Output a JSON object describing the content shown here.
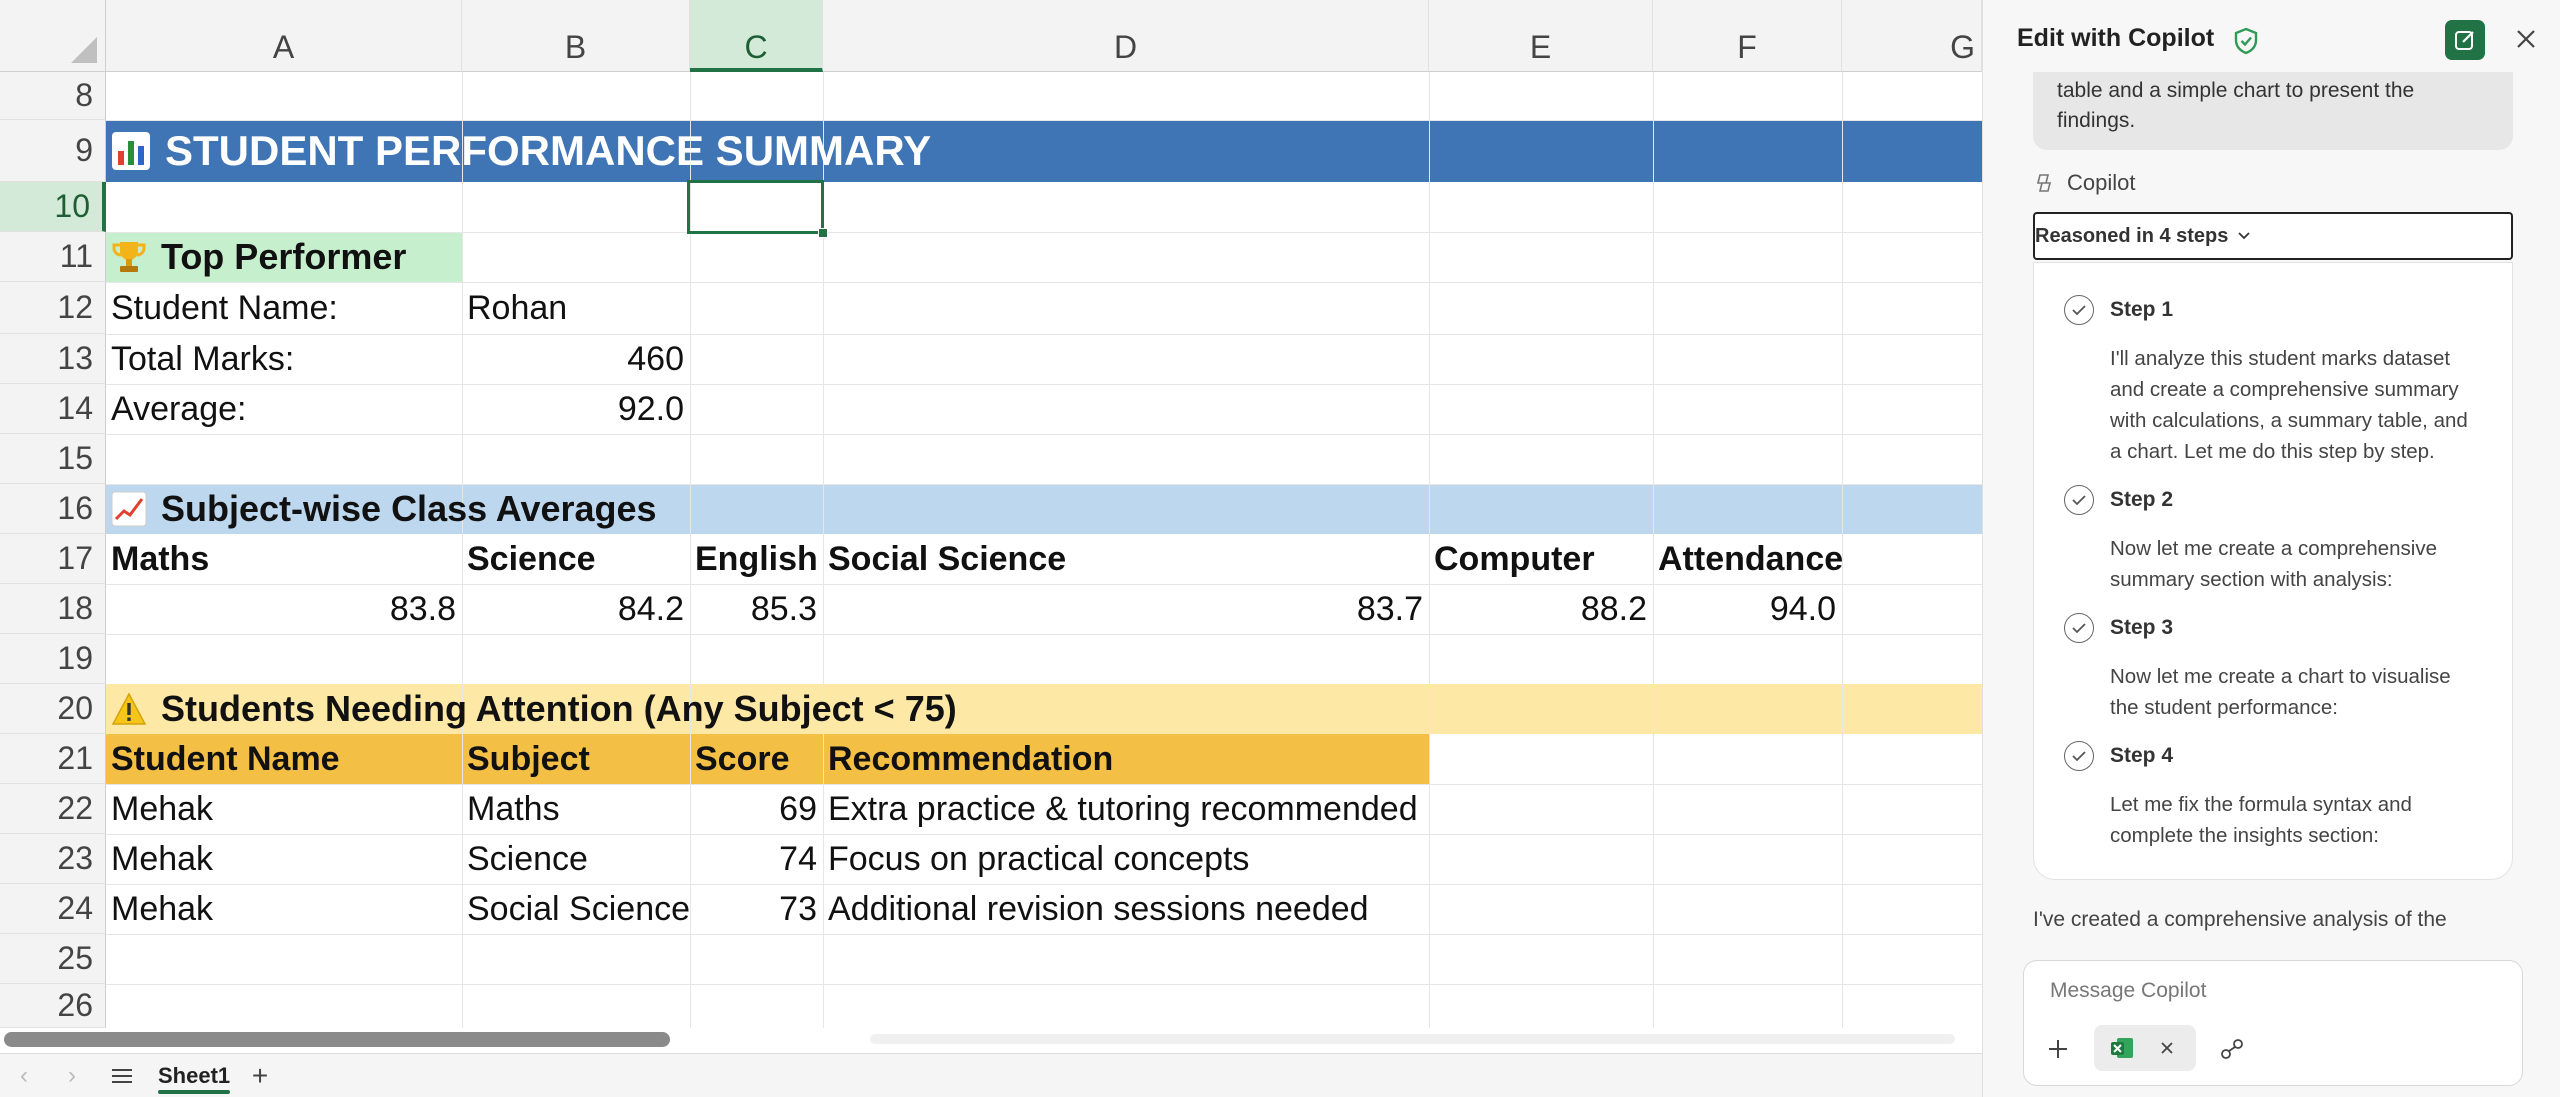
{
  "columns": [
    "A",
    "B",
    "C",
    "D",
    "E",
    "F",
    "G"
  ],
  "selected_column": "C",
  "rows": [
    "8",
    "9",
    "10",
    "11",
    "12",
    "13",
    "14",
    "15",
    "16",
    "17",
    "18",
    "19",
    "20",
    "21",
    "22",
    "23",
    "24",
    "25",
    "26"
  ],
  "selected_row": "10",
  "sheet": {
    "summary_title": "STUDENT PERFORMANCE SUMMARY",
    "top_performer": {
      "heading": "Top Performer",
      "name_label": "Student Name:",
      "name_value": "Rohan",
      "total_label": "Total Marks:",
      "total_value": "460",
      "avg_label": "Average:",
      "avg_value": "92.0"
    },
    "averages": {
      "heading": "Subject-wise Class Averages",
      "subjects": [
        "Maths",
        "Science",
        "English",
        "Social Science",
        "Computer",
        "Attendance"
      ],
      "values": [
        "83.8",
        "84.2",
        "85.3",
        "83.7",
        "88.2",
        "94.0"
      ]
    },
    "attention": {
      "heading": "Students Needing Attention (Any Subject < 75)",
      "headers": [
        "Student Name",
        "Subject",
        "Score",
        "Recommendation"
      ],
      "rows": [
        [
          "Mehak",
          "Maths",
          "69",
          "Extra practice & tutoring recommended"
        ],
        [
          "Mehak",
          "Science",
          "74",
          "Focus on practical concepts"
        ],
        [
          "Mehak",
          "Social Science",
          "73",
          "Additional revision sessions needed"
        ]
      ]
    }
  },
  "tabs": {
    "sheet_name": "Sheet1"
  },
  "copilot": {
    "title": "Edit with Copilot",
    "bubble_line1": "table and a simple chart to present the",
    "bubble_line2": "findings.",
    "sender": "Copilot",
    "reasoned": "Reasoned in 4 steps",
    "steps": [
      {
        "title": "Step 1",
        "lines": [
          "I'll analyze this student marks dataset",
          "and create a comprehensive summary",
          "with calculations, a summary table, and",
          "a chart. Let me do this step by step."
        ]
      },
      {
        "title": "Step 2",
        "lines": [
          "Now let me create a comprehensive",
          "summary section with analysis:"
        ]
      },
      {
        "title": "Step 3",
        "lines": [
          "Now let me create a chart to visualise",
          "the student performance:"
        ]
      },
      {
        "title": "Step 4",
        "lines": [
          "Let me fix the formula syntax and",
          "complete the insights section:"
        ]
      }
    ],
    "summary": "I've created a comprehensive analysis of the",
    "placeholder": "Message Copilot"
  },
  "colors": {
    "title_band": "#3f74b5",
    "top_performer_fill": "#c6efce",
    "averages_band": "#bdd7ee",
    "attention_band": "#fde9a5",
    "attention_header": "#f4bf45",
    "excel_green": "#217346"
  }
}
